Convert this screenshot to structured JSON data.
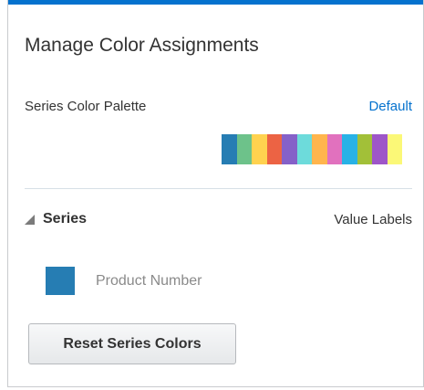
{
  "dialog": {
    "title": "Manage Color Assignments"
  },
  "palette": {
    "label": "Series Color Palette",
    "default_link": "Default",
    "colors": [
      "#267db3",
      "#6dc28a",
      "#ffd24f",
      "#ec6344",
      "#8561c8",
      "#6ddbdb",
      "#ffb54d",
      "#e171be",
      "#29b2e6",
      "#a2c038",
      "#9e56c8",
      "#fbf877"
    ]
  },
  "series": {
    "header_label": "Series",
    "value_labels": "Value Labels",
    "items": [
      {
        "name": "Product Number",
        "color": "#267db3"
      }
    ]
  },
  "actions": {
    "reset_label": "Reset Series Colors"
  },
  "theme": {
    "accent": "#0572ce"
  }
}
